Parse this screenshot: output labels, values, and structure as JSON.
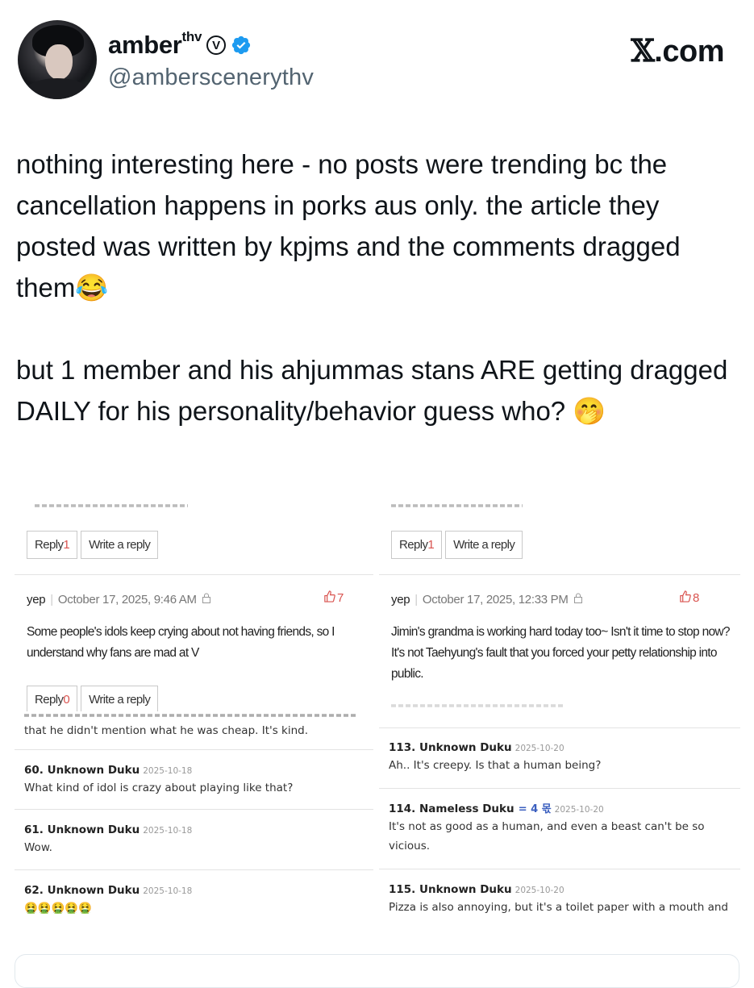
{
  "header": {
    "display_name": "amber",
    "display_name_sup": "thv",
    "badge_letter": "V",
    "handle": "@amberscenerythv",
    "brand_glyph": "𝕏",
    "brand_suffix": ".com",
    "verified_color": "#1d9bf0"
  },
  "tweet": {
    "paragraph1": "nothing interesting here - no posts were trending bc the cancellation happens in porks aus only. the article they posted was written by kpjms and the comments dragged them😂",
    "paragraph2": "but 1 member and his ahjummas stans ARE getting dragged DAILY for his personality/behavior guess who? 🤭"
  },
  "screenshot": {
    "left_top": {
      "reply_label": "Reply",
      "reply_count": "1",
      "write_label": "Write a reply",
      "comment": {
        "user": "yep",
        "date": "October 17, 2025, 9:46 AM",
        "likes": "7",
        "text": "Some people's idols keep crying about not having friends, so I understand why fans are mad at V"
      },
      "reply_count2": "0"
    },
    "right_top": {
      "reply_label": "Reply",
      "reply_count": "1",
      "write_label": "Write a reply",
      "comment": {
        "user": "yep",
        "date": "October 17, 2025, 12:33 PM",
        "likes": "8",
        "text": "Jimin's grandma is working hard today too~ Isn't it time to stop now? It's not Taehyung's fault that you forced your petty relationship into public."
      }
    },
    "left_bottom": {
      "cut_text": "that he didn't mention what he was cheap. It's kind.",
      "posts": [
        {
          "name": "60. Unknown Duku",
          "date": "2025-10-18",
          "body": "What kind of idol is crazy about playing like that?"
        },
        {
          "name": "61. Unknown Duku",
          "date": "2025-10-18",
          "body": "Wow."
        },
        {
          "name": "62. Unknown Duku",
          "date": "2025-10-18",
          "body": "🤮🤮🤮🤮🤮"
        }
      ]
    },
    "right_bottom": {
      "posts": [
        {
          "name": "113. Unknown Duku",
          "date": "2025-10-20",
          "body": "Ah.. It's creepy. Is that a human being?"
        },
        {
          "name": "114. Nameless Duku",
          "tag": "= 4 몫",
          "date": "2025-10-20",
          "body": "It's not as good as a human, and even a beast can't be so vicious."
        },
        {
          "name": "115. Unknown Duku",
          "date": "2025-10-20",
          "body": "Pizza is also annoying, but it's a toilet paper with a mouth and"
        }
      ]
    }
  }
}
